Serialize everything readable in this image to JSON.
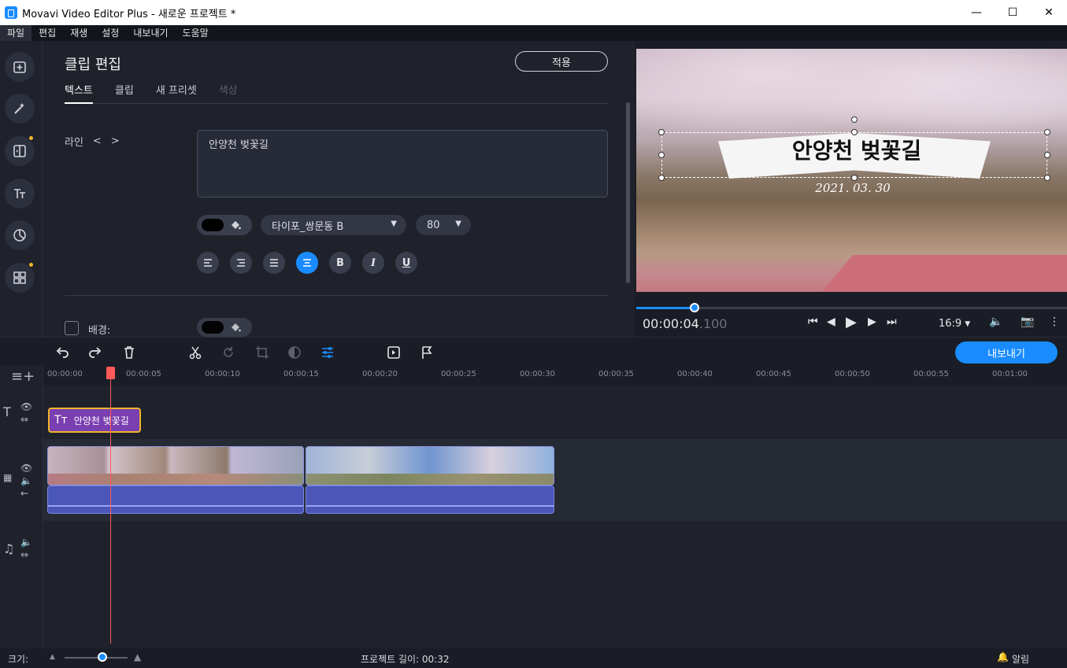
{
  "window": {
    "title": "Movavi Video Editor Plus - 새로운 프로젝트 *",
    "minimize": "—",
    "maximize": "☐",
    "close": "✕"
  },
  "menu": [
    "파일",
    "편집",
    "재생",
    "설정",
    "내보내기",
    "도움말"
  ],
  "editor": {
    "title": "클립 편집",
    "apply": "적용",
    "tabs": [
      "텍스트",
      "클립",
      "새 프리셋",
      "색상"
    ],
    "line_label": "라인",
    "text_value": "안양천 벚꽃길",
    "font": "타이포_쌍문동 B",
    "size": "80",
    "background_label": "배경:"
  },
  "preview": {
    "title_text": "안양천 벚꽃길",
    "date_text": "2021. 03. 30",
    "timecode_main": "00:00:04",
    "timecode_ms": ".100",
    "aspect": "16:9",
    "progress": 0.136
  },
  "toolbar": {
    "export": "내보내기"
  },
  "ruler": {
    "ticks": [
      "00:00:00",
      "00:00:05",
      "00:00:10",
      "00:00:15",
      "00:00:20",
      "00:00:25",
      "00:00:30",
      "00:00:35",
      "00:00:40",
      "00:00:45",
      "00:00:50",
      "00:00:55",
      "00:01:00"
    ]
  },
  "timeline": {
    "title_clip": "안양천 벚꽃길"
  },
  "status": {
    "zoom_label": "크기:",
    "project_length": "프로젝트 길이:  00:32",
    "alerts": "알림"
  },
  "colors": {
    "accent": "#1a8cff",
    "title_clip": "#7a3fb0",
    "selection": "#f0b429",
    "playhead": "#ff5a5a"
  }
}
